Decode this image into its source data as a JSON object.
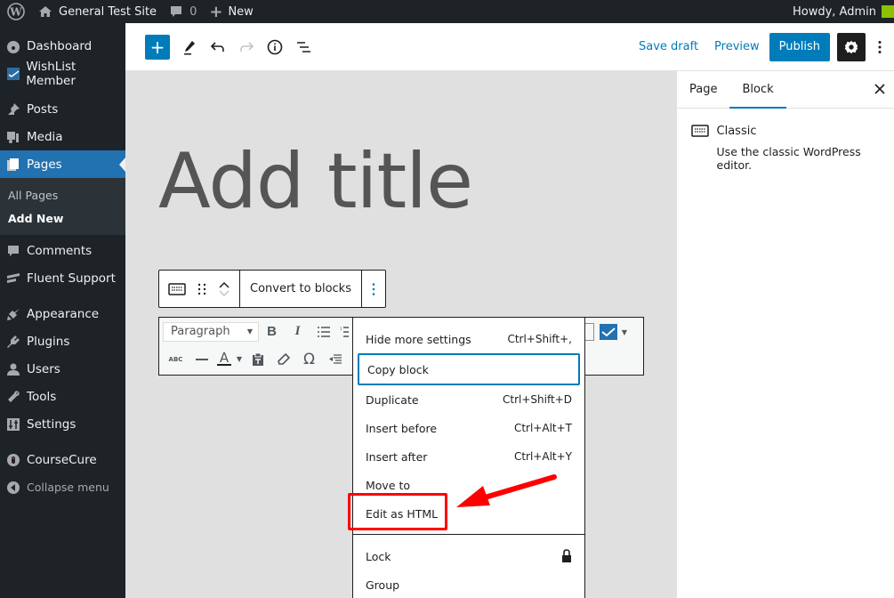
{
  "admin_bar": {
    "site_name": "General Test Site",
    "comments_count": "0",
    "new_label": "New",
    "greeting": "Howdy, Admin"
  },
  "sidebar": {
    "items": [
      {
        "label": "Dashboard",
        "icon": "dashboard-icon"
      },
      {
        "label": "WishList Member",
        "icon": "wishlist-icon"
      },
      {
        "label": "Posts",
        "icon": "pin-icon"
      },
      {
        "label": "Media",
        "icon": "media-icon"
      },
      {
        "label": "Pages",
        "icon": "pages-icon",
        "active": true
      },
      {
        "label": "Comments",
        "icon": "comment-icon"
      },
      {
        "label": "Fluent Support",
        "icon": "fluent-icon"
      },
      {
        "label": "Appearance",
        "icon": "brush-icon"
      },
      {
        "label": "Plugins",
        "icon": "plugin-icon"
      },
      {
        "label": "Users",
        "icon": "user-icon"
      },
      {
        "label": "Tools",
        "icon": "wrench-icon"
      },
      {
        "label": "Settings",
        "icon": "sliders-icon"
      },
      {
        "label": "CourseCure",
        "icon": "coursecure-icon"
      }
    ],
    "submenu": [
      {
        "label": "All Pages"
      },
      {
        "label": "Add New",
        "current": true
      }
    ],
    "collapse_label": "Collapse menu"
  },
  "header": {
    "save_draft": "Save draft",
    "preview": "Preview",
    "publish": "Publish"
  },
  "canvas": {
    "title_placeholder": "Add title",
    "block_toolbar": {
      "convert_label": "Convert to blocks"
    },
    "classic_toolbar": {
      "format_select": "Paragraph"
    }
  },
  "dropdown": {
    "items": [
      {
        "label": "Hide more settings",
        "shortcut": "Ctrl+Shift+,"
      },
      {
        "label": "Copy block",
        "shortcut": ""
      },
      {
        "label": "Duplicate",
        "shortcut": "Ctrl+Shift+D"
      },
      {
        "label": "Insert before",
        "shortcut": "Ctrl+Alt+T"
      },
      {
        "label": "Insert after",
        "shortcut": "Ctrl+Alt+Y"
      },
      {
        "label": "Move to",
        "shortcut": ""
      },
      {
        "label": "Edit as HTML",
        "shortcut": ""
      }
    ],
    "items2": [
      {
        "label": "Lock"
      },
      {
        "label": "Group"
      }
    ]
  },
  "inspector": {
    "tabs": [
      "Page",
      "Block"
    ],
    "active_tab": "Block",
    "block_name": "Classic",
    "block_description": "Use the classic WordPress editor."
  },
  "colors": {
    "accent": "#007cba",
    "admin_bg": "#1d2327",
    "active_menu": "#2271b1",
    "annotation": "#ff0000"
  }
}
